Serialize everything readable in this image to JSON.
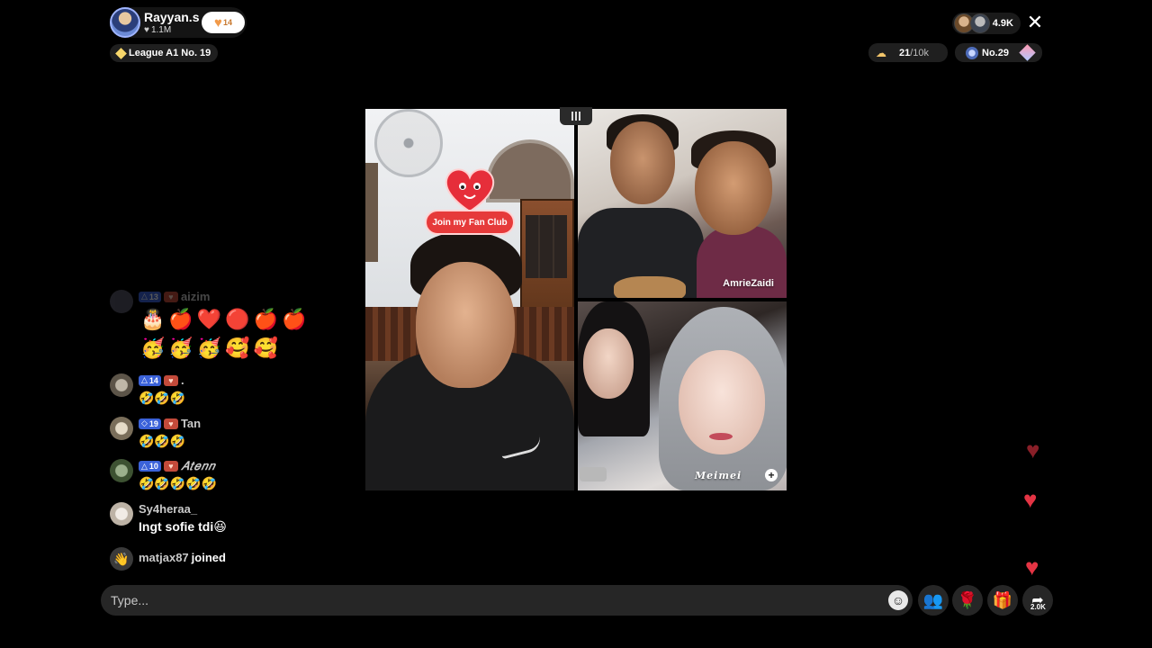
{
  "host": {
    "name": "Rayyan.s",
    "likes": "1.1M",
    "fan_club_level": "14",
    "league": "League A1 No. 19"
  },
  "top_right": {
    "viewer_count": "4.9K",
    "goal_current": "21",
    "goal_target": "/10k",
    "rank": "No.29"
  },
  "sticker": {
    "label": "Join my Fan Club"
  },
  "guests": [
    {
      "name": "AmrieZaidi"
    },
    {
      "name": "𝑴𝒆𝒊𝒎𝒆𝒊"
    }
  ],
  "chat": [
    {
      "level": "13",
      "user": "aizim",
      "text": "",
      "emojis_row1": "🎂🍎❤️🔴🍎🍎",
      "emojis_row2": "🥳🥳🥳🥰🥰"
    },
    {
      "level": "14",
      "user": ".",
      "text": "🤣🤣🤣"
    },
    {
      "level": "19",
      "user": "Tan",
      "text": "🤣🤣🤣"
    },
    {
      "level": "10",
      "user": "𝐴𝑡𝑒𝑛𝑛",
      "text": "🤣🤣🤣🤣🤣"
    },
    {
      "user": "Sy4heraa_",
      "text": "Ingt sofie tdi😆"
    },
    {
      "user": "matjax87",
      "text": "joined"
    }
  ],
  "input": {
    "placeholder": "Type..."
  },
  "share_count": "2.0K",
  "colors": {
    "accent_red": "#e43444",
    "level_badge": "#3b62d9",
    "background": "#000000"
  }
}
